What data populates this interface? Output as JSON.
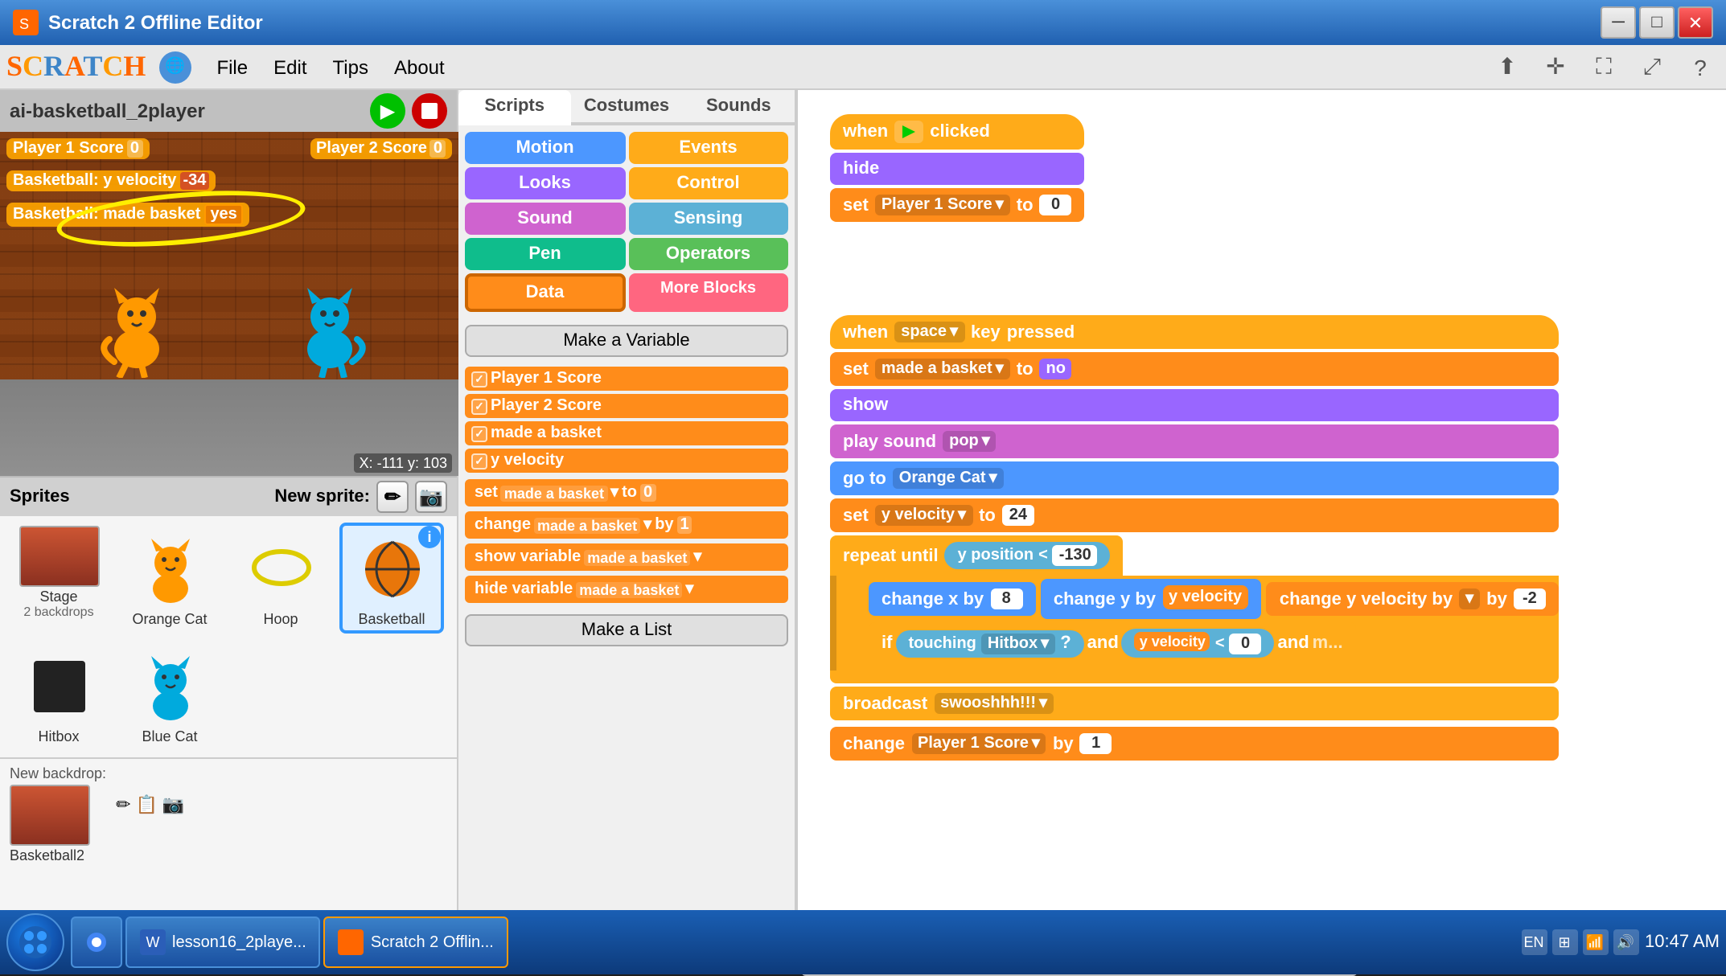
{
  "window": {
    "title": "Scratch 2 Offline Editor",
    "icon": "scratch-icon"
  },
  "menu": {
    "logo": "SCRATCH",
    "items": [
      "File",
      "Edit",
      "Tips",
      "About"
    ]
  },
  "project": {
    "name": "ai-basketball_2player"
  },
  "tabs": {
    "scripts": "Scripts",
    "costumes": "Costumes",
    "sounds": "Sounds"
  },
  "categories": {
    "motion": "Motion",
    "looks": "Looks",
    "sound": "Sound",
    "pen": "Pen",
    "data": "Data",
    "events": "Events",
    "control": "Control",
    "sensing": "Sensing",
    "operators": "Operators",
    "more": "More Blocks"
  },
  "hud": {
    "p1score_label": "Player 1 Score",
    "p1score_val": "0",
    "p2score_label": "Player 2 Score",
    "p2score_val": "0",
    "yvel_label": "Basketball: y velocity",
    "yvel_val": "-34",
    "made_label": "Basketball: made basket",
    "made_val": "yes"
  },
  "coords": {
    "display": "X: -111  y: 103"
  },
  "variables": {
    "make_btn": "Make a Variable",
    "items": [
      "Player 1 Score",
      "Player 2 Score",
      "made a basket",
      "y velocity"
    ],
    "set_made": "set",
    "set_made_var": "made a basket",
    "set_made_to": "to",
    "set_made_val": "0",
    "change_var": "change",
    "change_made": "made a basket",
    "change_by": "by",
    "change_val": "1",
    "show_var": "show variable",
    "show_var_name": "made a basket",
    "hide_var": "hide variable",
    "hide_var_name": "made a basket",
    "make_list": "Make a List"
  },
  "sprites": {
    "header": "Sprites",
    "new_sprite": "New sprite:",
    "items": [
      {
        "name": "Stage",
        "sub": "2 backdrops",
        "icon": "stage"
      },
      {
        "name": "Orange Cat",
        "sub": "",
        "icon": "cat-orange"
      },
      {
        "name": "Hoop",
        "sub": "",
        "icon": "hoop"
      },
      {
        "name": "Basketball",
        "sub": "",
        "icon": "basketball",
        "selected": true
      },
      {
        "name": "Hitbox",
        "sub": "",
        "icon": "hitbox"
      },
      {
        "name": "Blue Cat",
        "sub": "",
        "icon": "cat-blue"
      }
    ],
    "new_backdrop_label": "New backdrop:"
  },
  "scripts": {
    "when_clicked": "when",
    "clicked": "clicked",
    "hide": "hide",
    "set": "set",
    "player1_score": "Player 1 Score",
    "to": "to",
    "zero": "0",
    "when_space": "when",
    "space": "space",
    "key": "key",
    "pressed": "pressed",
    "set2": "set",
    "made_basket": "made a basket",
    "to2": "to",
    "no": "no",
    "show": "show",
    "play_sound": "play sound",
    "pop": "pop",
    "go_to": "go to",
    "orange_cat": "Orange Cat",
    "set3": "set",
    "y_velocity": "y velocity",
    "to3": "to",
    "val24": "24",
    "repeat_until": "repeat until",
    "y_position": "y position",
    "lt": "<",
    "neg130": "-130",
    "change_x": "change x by",
    "val8": "8",
    "change_y": "change y by",
    "y_vel_ref": "y velocity",
    "change_yvel": "change y velocity by",
    "neg2": "-2",
    "if": "if",
    "touching": "touching",
    "hitbox": "Hitbox",
    "and": "and",
    "y_vel_lt": "y velocity",
    "lt2": "<",
    "val0": "0",
    "and2": "and",
    "more": "m...",
    "broadcast": "broadcast",
    "swooshhh": "swooshhh!!!",
    "change_p1score": "change",
    "player1score_ref": "Player 1 Score",
    "by": "by",
    "val1": "1"
  },
  "taskbar": {
    "time": "10:47 AM",
    "lang": "EN",
    "items": [
      {
        "label": "lesson16_2playe...",
        "icon": "word-icon"
      },
      {
        "label": "Scratch 2 Offlin...",
        "icon": "scratch-icon"
      }
    ]
  },
  "zoom": {
    "minus": "−",
    "reset": "=",
    "plus": "+"
  }
}
